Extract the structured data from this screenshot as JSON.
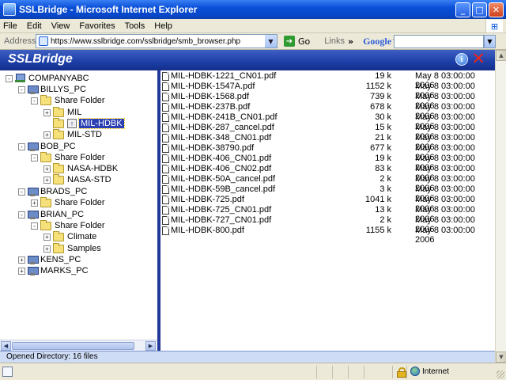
{
  "window": {
    "title": "SSLBridge - Microsoft Internet Explorer",
    "minimize_label": "_",
    "maximize_label": "□",
    "close_label": "✕"
  },
  "menu": [
    "File",
    "Edit",
    "View",
    "Favorites",
    "Tools",
    "Help"
  ],
  "address": {
    "label": "Address",
    "url": "https://www.sslbridge.com/sslbridge/smb_browser.php",
    "go_label": "Go",
    "links_label": "Links",
    "links_chevron": "»",
    "google_label": "Google",
    "search_value": ""
  },
  "app": {
    "title": "SSLBridge",
    "info_label": "i",
    "close_label": "✕",
    "status": "Opened Directory: 16 files"
  },
  "tree": [
    {
      "label": "COMPANYABC",
      "kind": "network",
      "expander": "-"
    },
    {
      "label": "BILLYS_PC",
      "kind": "pc",
      "expander": "-"
    },
    {
      "label": "Share Folder",
      "kind": "folder",
      "expander": "-"
    },
    {
      "label": "MIL",
      "kind": "folder",
      "expander": "+"
    },
    {
      "label": "MIL-HDBK",
      "kind": "folder-up",
      "expander": "",
      "selected": true
    },
    {
      "label": "MIL-STD",
      "kind": "folder",
      "expander": "+"
    },
    {
      "label": "BOB_PC",
      "kind": "pc",
      "expander": "-"
    },
    {
      "label": "Share Folder",
      "kind": "folder",
      "expander": "-"
    },
    {
      "label": "NASA-HDBK",
      "kind": "folder",
      "expander": "+"
    },
    {
      "label": "NASA-STD",
      "kind": "folder",
      "expander": "+"
    },
    {
      "label": "BRADS_PC",
      "kind": "pc",
      "expander": "-"
    },
    {
      "label": "Share Folder",
      "kind": "folder",
      "expander": "+"
    },
    {
      "label": "BRIAN_PC",
      "kind": "pc",
      "expander": "-"
    },
    {
      "label": "Share Folder",
      "kind": "folder",
      "expander": "-"
    },
    {
      "label": "Climate",
      "kind": "folder",
      "expander": "+"
    },
    {
      "label": "Samples",
      "kind": "folder",
      "expander": "+"
    },
    {
      "label": "KENS_PC",
      "kind": "pc",
      "expander": "+"
    },
    {
      "label": "MARKS_PC",
      "kind": "pc",
      "expander": "+"
    }
  ],
  "files": [
    {
      "name": "MIL-HDBK-1221_CN01.pdf",
      "size": "19 k",
      "date": "May 8 03:00:00 2006"
    },
    {
      "name": "MIL-HDBK-1547A.pdf",
      "size": "1152 k",
      "date": "May 8 03:00:00 2006"
    },
    {
      "name": "MIL-HDBK-1568.pdf",
      "size": "739 k",
      "date": "May 8 03:00:00 2006"
    },
    {
      "name": "MIL-HDBK-237B.pdf",
      "size": "678 k",
      "date": "May 8 03:00:00 2006"
    },
    {
      "name": "MIL-HDBK-241B_CN01.pdf",
      "size": "30 k",
      "date": "May 8 03:00:00 2006"
    },
    {
      "name": "MIL-HDBK-287_cancel.pdf",
      "size": "15 k",
      "date": "May 8 03:00:00 2006"
    },
    {
      "name": "MIL-HDBK-348_CN01.pdf",
      "size": "21 k",
      "date": "May 8 03:00:00 2006"
    },
    {
      "name": "MIL-HDBK-38790.pdf",
      "size": "677 k",
      "date": "May 8 03:00:00 2006"
    },
    {
      "name": "MIL-HDBK-406_CN01.pdf",
      "size": "19 k",
      "date": "May 8 03:00:00 2006"
    },
    {
      "name": "MIL-HDBK-406_CN02.pdf",
      "size": "83 k",
      "date": "May 8 03:00:00 2006"
    },
    {
      "name": "MIL-HDBK-50A_cancel.pdf",
      "size": "2 k",
      "date": "May 8 03:00:00 2006"
    },
    {
      "name": "MIL-HDBK-59B_cancel.pdf",
      "size": "3 k",
      "date": "May 8 03:00:00 2006"
    },
    {
      "name": "MIL-HDBK-725.pdf",
      "size": "1041 k",
      "date": "May 8 03:00:00 2006"
    },
    {
      "name": "MIL-HDBK-725_CN01.pdf",
      "size": "13 k",
      "date": "May 8 03:00:00 2006"
    },
    {
      "name": "MIL-HDBK-727_CN01.pdf",
      "size": "2 k",
      "date": "May 8 03:00:00 2006"
    },
    {
      "name": "MIL-HDBK-800.pdf",
      "size": "1155 k",
      "date": "May 8 03:00:00 2006"
    }
  ],
  "ie_status": {
    "text": "",
    "zone": "Internet"
  },
  "colors": {
    "app_header": "#1b3ea6",
    "selection": "#2a3fb3",
    "splitter": "#23399a"
  }
}
